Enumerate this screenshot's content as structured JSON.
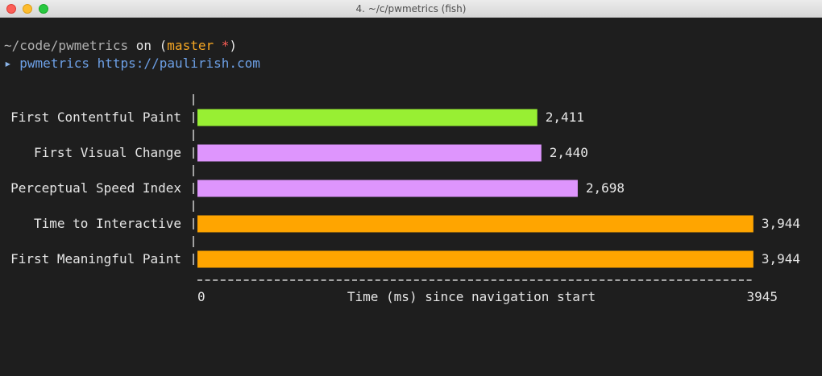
{
  "window": {
    "title": "4. ~/c/pwmetrics (fish)"
  },
  "prompt": {
    "path": "~/code/pwmetrics",
    "on": " on (",
    "branch": "master",
    "dirty": " *",
    "close_paren": ")",
    "arrow": "▸",
    "command": "pwmetrics",
    "url": "https://paulirish.com"
  },
  "colors": {
    "green": "#98ef33",
    "violet": "#de95fd",
    "orange": "#ffa500",
    "background": "#1e1e1e",
    "text": "#e6e6e6"
  },
  "chart_data": {
    "type": "bar",
    "orientation": "horizontal",
    "categories": [
      "First Contentful Paint",
      "First Visual Change",
      "Perceptual Speed Index",
      "Time to Interactive",
      "First Meaningful Paint"
    ],
    "values": [
      2411,
      2440,
      2698,
      3944,
      3944
    ],
    "value_labels": [
      "2,411",
      "2,440",
      "2,698",
      "3,944",
      "3,944"
    ],
    "bar_colors": [
      "#98ef33",
      "#de95fd",
      "#de95fd",
      "#ffa500",
      "#ffa500"
    ],
    "xlabel": "Time (ms) since navigation start",
    "xlim": [
      0,
      3945
    ],
    "xmin_label": "0",
    "xmax_label": "3945",
    "grid": false
  }
}
